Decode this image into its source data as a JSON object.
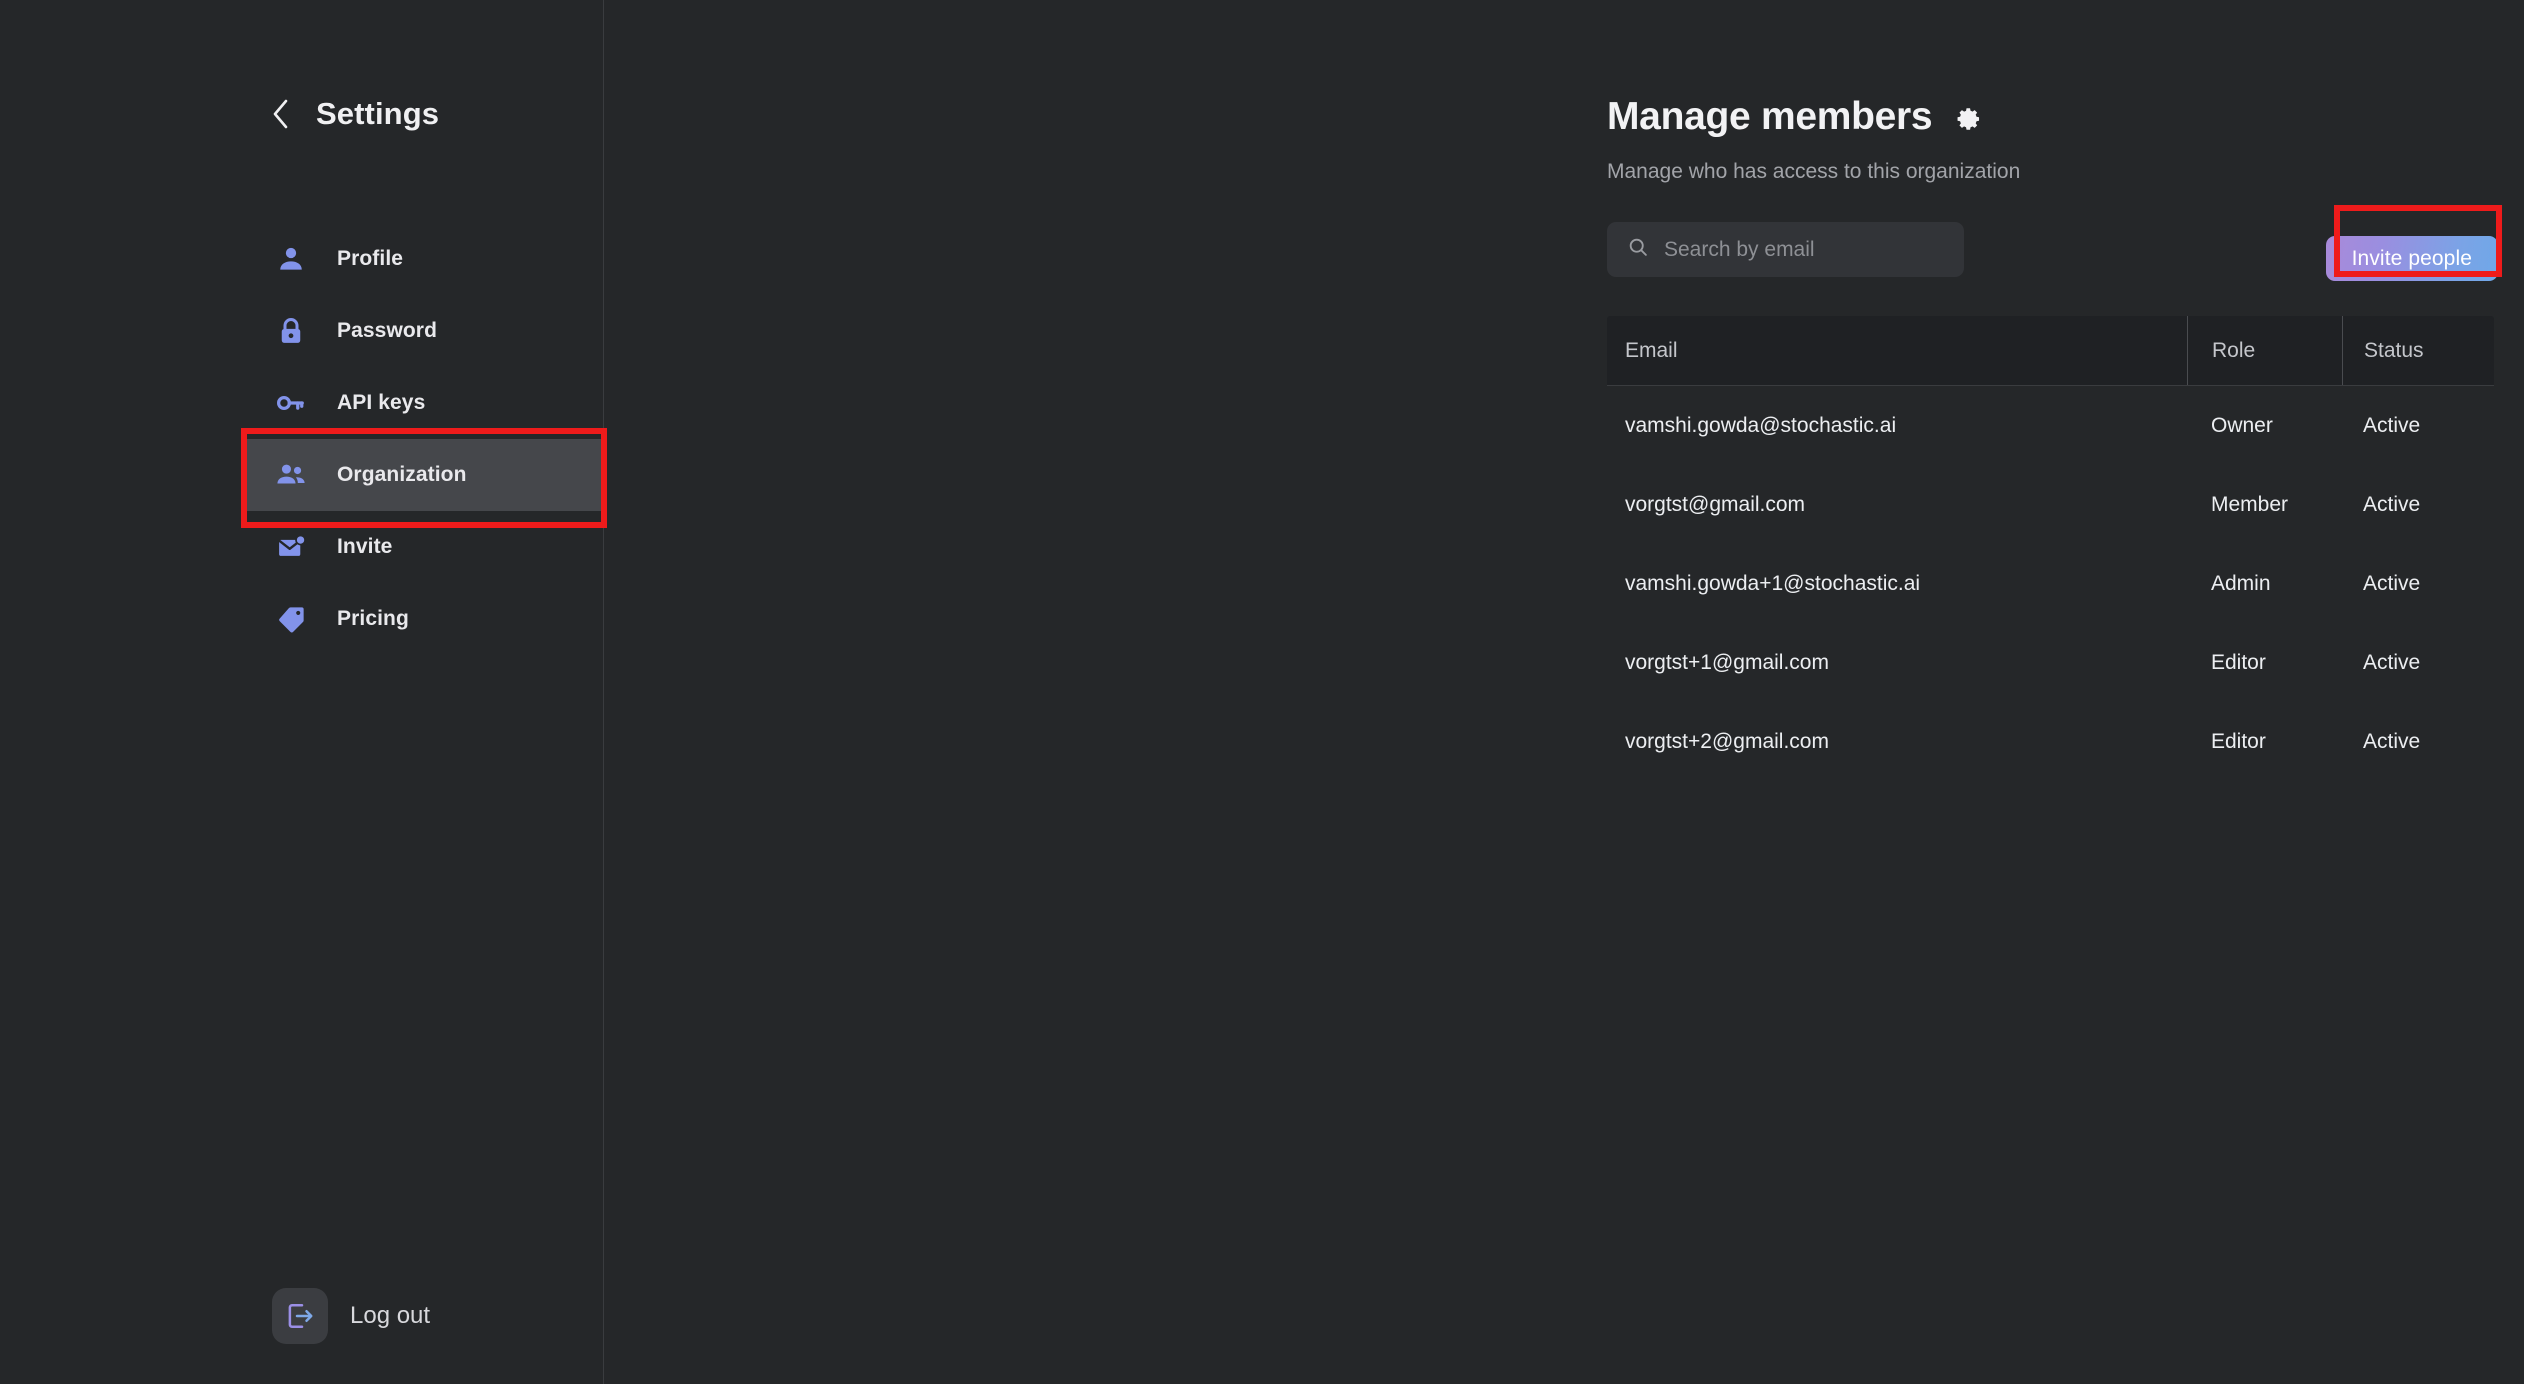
{
  "sidebar": {
    "back_icon": "chevron-left-icon",
    "title": "Settings",
    "items": [
      {
        "label": "Profile",
        "icon": "person-icon",
        "active": false
      },
      {
        "label": "Password",
        "icon": "lock-icon",
        "active": false
      },
      {
        "label": "API keys",
        "icon": "key-icon",
        "active": false
      },
      {
        "label": "Organization",
        "icon": "people-icon",
        "active": true
      },
      {
        "label": "Invite",
        "icon": "envelope-icon",
        "active": false
      },
      {
        "label": "Pricing",
        "icon": "tag-icon",
        "active": false
      }
    ],
    "logout": {
      "label": "Log out",
      "icon": "logout-icon"
    }
  },
  "main": {
    "title": "Manage members",
    "settings_icon": "gear-icon",
    "subtitle": "Manage who has access to this organization",
    "search": {
      "placeholder": "Search by email",
      "value": "",
      "icon": "search-icon"
    },
    "invite_button": "Invite people",
    "table": {
      "columns": [
        "Email",
        "Role",
        "Status"
      ],
      "rows": [
        {
          "email": "vamshi.gowda@stochastic.ai",
          "role": "Owner",
          "status": "Active"
        },
        {
          "email": "vorgtst@gmail.com",
          "role": "Member",
          "status": "Active"
        },
        {
          "email": "vamshi.gowda+1@stochastic.ai",
          "role": "Admin",
          "status": "Active"
        },
        {
          "email": "vorgtst+1@gmail.com",
          "role": "Editor",
          "status": "Active"
        },
        {
          "email": "vorgtst+2@gmail.com",
          "role": "Editor",
          "status": "Active"
        }
      ]
    }
  },
  "annotations": {
    "highlight_color": "#ee1b1b",
    "highlighted": [
      "Organization",
      "Invite people"
    ]
  },
  "colors": {
    "background": "#252729",
    "sidebar_active": "#45474b",
    "icon_accent": "#8293ea",
    "accent_start": "#a98ad9",
    "accent_end": "#6fa8e8"
  }
}
